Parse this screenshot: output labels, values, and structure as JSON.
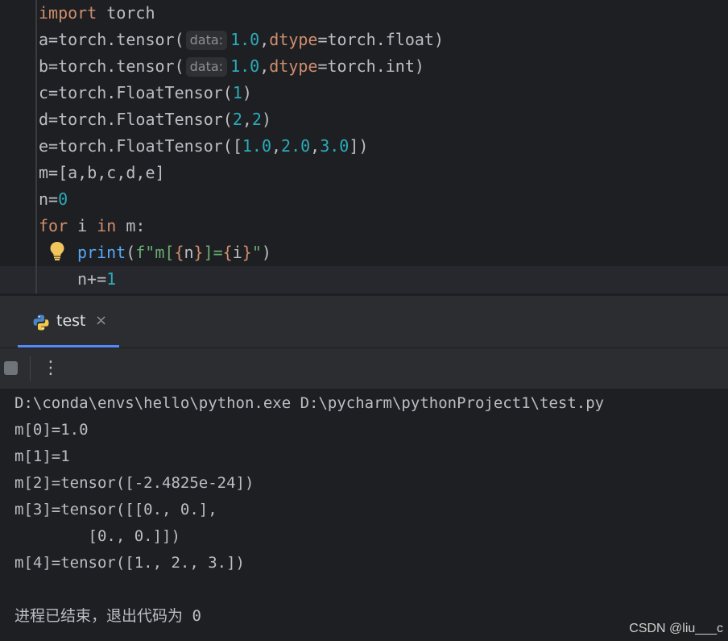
{
  "editor": {
    "line_import": [
      "import",
      " torch"
    ],
    "line_a": {
      "prefix": "a=torch.tensor(",
      "hint": "data:",
      "num": "1.0",
      "comma": ",",
      "param": "dtype",
      "rest": "=torch.float)"
    },
    "line_b": {
      "prefix": "b=torch.tensor(",
      "hint": "data:",
      "num": "1.0",
      "comma": ",",
      "param": "dtype",
      "rest": "=torch.int)"
    },
    "line_c": {
      "prefix": "c=torch.FloatTensor(",
      "num": "1",
      "suffix": ")"
    },
    "line_d": {
      "prefix": "d=torch.FloatTensor(",
      "num1": "2",
      "comma": ",",
      "num2": "2",
      "suffix": ")"
    },
    "line_e": {
      "prefix": "e=torch.FloatTensor([",
      "n1": "1.0",
      "c1": ",",
      "n2": "2.0",
      "c2": ",",
      "n3": "3.0",
      "suffix": "])"
    },
    "line_m": "m=[a,b,c,d,e]",
    "line_n": {
      "prefix": "n=",
      "num": "0"
    },
    "line_for": {
      "kw1": "for",
      "mid1": " i ",
      "kw2": "in",
      "mid2": " m:"
    },
    "line_print": {
      "fn": "print",
      "open": "(",
      "s1": "f\"m[",
      "b1": "{",
      "v1": "n",
      "b2": "}",
      "s2": "]=",
      "b3": "{",
      "v2": "i",
      "b4": "}",
      "s3": "\"",
      "close": ")"
    },
    "line_inc": {
      "prefix": "n+=",
      "num": "1"
    }
  },
  "run_tab": {
    "label": "test",
    "close": "×"
  },
  "toolbar": {
    "more": "⋮"
  },
  "console": {
    "lines": [
      "D:\\conda\\envs\\hello\\python.exe D:\\pycharm\\pythonProject1\\test.py",
      "m[0]=1.0",
      "m[1]=1",
      "m[2]=tensor([-2.4825e-24])",
      "m[3]=tensor([[0., 0.],",
      "        [0., 0.]])",
      "m[4]=tensor([1., 2., 3.])"
    ],
    "exit": "进程已结束，退出代码为 0"
  },
  "watermark": "CSDN @liu___c",
  "icons": {
    "bulb": "lightbulb-icon",
    "python": "python-icon",
    "close": "close-icon",
    "stop": "stop-icon",
    "more": "more-vertical-icon"
  },
  "colors": {
    "keyword": "#cf8e6d",
    "number": "#2aacb8",
    "string": "#6aab73",
    "function": "#56a8f5",
    "accent": "#548af7"
  }
}
